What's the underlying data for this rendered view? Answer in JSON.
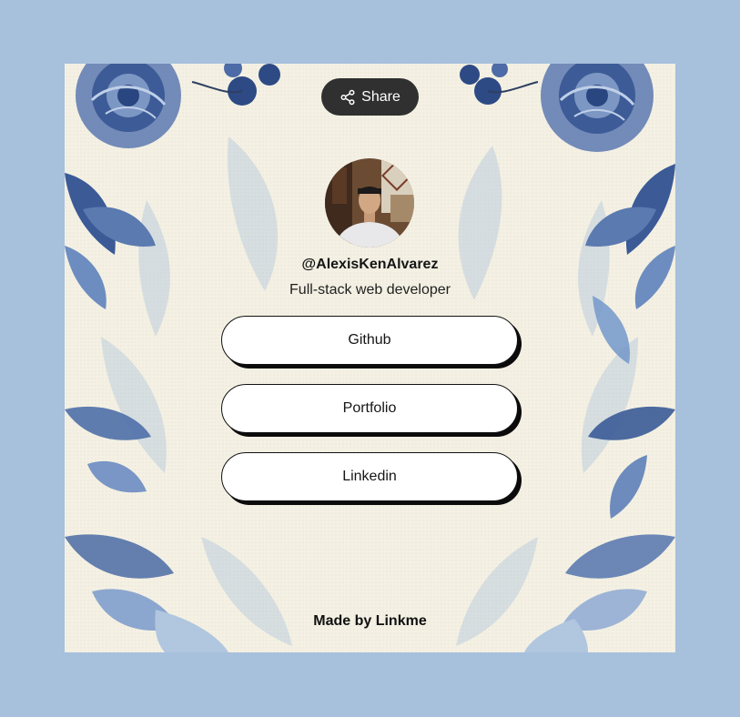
{
  "share": {
    "label": "Share",
    "icon": "share-icon"
  },
  "profile": {
    "username": "@AlexisKenAlvarez",
    "bio": "Full-stack web developer"
  },
  "links": [
    {
      "label": "Github"
    },
    {
      "label": "Portfolio"
    },
    {
      "label": "Linkedin"
    }
  ],
  "footer": {
    "text": "Made by Linkme"
  },
  "colors": {
    "page_background": "#a7c0dc",
    "card_background": "#f4f1e4",
    "share_button": "#2f302f",
    "floral_dark": "#2c4a86",
    "floral_light": "#8aaed6"
  }
}
